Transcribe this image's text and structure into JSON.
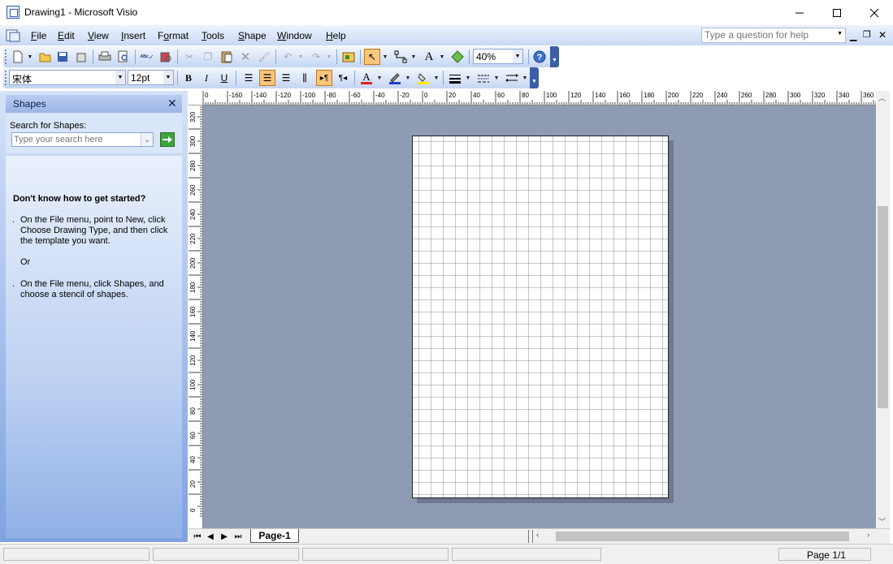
{
  "window": {
    "title": "Drawing1 - Microsoft Visio"
  },
  "menu": {
    "items": [
      {
        "label": "File",
        "u": "F",
        "rest": "ile"
      },
      {
        "label": "Edit",
        "u": "E",
        "rest": "dit"
      },
      {
        "label": "View",
        "u": "V",
        "rest": "iew"
      },
      {
        "label": "Insert",
        "u": "I",
        "rest": "nsert"
      },
      {
        "label": "Format",
        "u": "o",
        "pre": "F",
        "rest": "rmat"
      },
      {
        "label": "Tools",
        "u": "T",
        "rest": "ools"
      },
      {
        "label": "Shape",
        "u": "S",
        "rest": "hape"
      },
      {
        "label": "Window",
        "u": "W",
        "rest": "indow"
      },
      {
        "label": "Help",
        "u": "H",
        "rest": "elp"
      }
    ],
    "help_placeholder": "Type a question for help"
  },
  "toolbar": {
    "zoom": "40%"
  },
  "format_toolbar": {
    "font": "宋体",
    "size": "12pt"
  },
  "shapes_pane": {
    "title": "Shapes",
    "search_label": "Search for Shapes:",
    "search_placeholder": "Type your search here",
    "help_heading": "Don't know how to get started?",
    "tip1": "On the File menu, point to New, click Choose Drawing Type, and then click the template you want.",
    "or": "Or",
    "tip2": "On the File menu, click Shapes, and choose a stencil of shapes."
  },
  "ruler": {
    "top_labels": [
      "0",
      "-160",
      "-140",
      "-120",
      "-100",
      "-80",
      "-60",
      "-40",
      "-20",
      "0",
      "20",
      "40",
      "60",
      "80",
      "100",
      "120",
      "140",
      "160",
      "180",
      "200",
      "220",
      "240",
      "260",
      "280",
      "300",
      "320",
      "340",
      "360"
    ],
    "left_labels": [
      "320",
      "300",
      "280",
      "260",
      "240",
      "220",
      "200",
      "180",
      "160",
      "140",
      "120",
      "100",
      "80",
      "60",
      "40",
      "20",
      "0"
    ]
  },
  "page_tab": {
    "label": "Page-1"
  },
  "status": {
    "page": "Page 1/1"
  }
}
